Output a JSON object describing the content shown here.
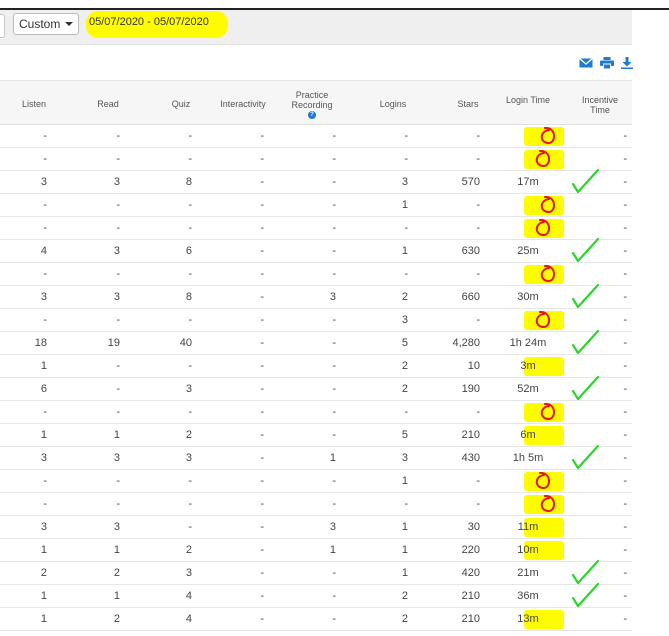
{
  "toolbar": {
    "period": "Custom",
    "date_range": "05/07/2020 - 05/07/2020"
  },
  "icons": {
    "email": "envelope-icon",
    "print": "printer-icon",
    "download": "download-icon"
  },
  "columns": [
    {
      "key": "listen",
      "label": "Listen"
    },
    {
      "key": "read",
      "label": "Read"
    },
    {
      "key": "quiz",
      "label": "Quiz"
    },
    {
      "key": "interactivity",
      "label": "Interactivity"
    },
    {
      "key": "practice",
      "label": "Practice Recording"
    },
    {
      "key": "logins",
      "label": "Logins"
    },
    {
      "key": "stars",
      "label": "Stars"
    },
    {
      "key": "login_time",
      "label": "Login Time"
    },
    {
      "key": "incentive",
      "label": "Incentive Time"
    }
  ],
  "rows": [
    [
      "-",
      "-",
      "-",
      "-",
      "-",
      "-",
      "-",
      "",
      "-"
    ],
    [
      "-",
      "-",
      "-",
      "-",
      "-",
      "-",
      "-",
      "",
      "-"
    ],
    [
      "3",
      "3",
      "8",
      "-",
      "-",
      "3",
      "570",
      "17m",
      "-"
    ],
    [
      "-",
      "-",
      "-",
      "-",
      "-",
      "1",
      "-",
      "",
      "-"
    ],
    [
      "-",
      "-",
      "-",
      "-",
      "-",
      "-",
      "-",
      "",
      "-"
    ],
    [
      "4",
      "3",
      "6",
      "-",
      "-",
      "1",
      "630",
      "25m",
      "-"
    ],
    [
      "-",
      "-",
      "-",
      "-",
      "-",
      "-",
      "-",
      "",
      "-"
    ],
    [
      "3",
      "3",
      "8",
      "-",
      "3",
      "2",
      "660",
      "30m",
      "-"
    ],
    [
      "-",
      "-",
      "-",
      "-",
      "-",
      "3",
      "-",
      "",
      "-"
    ],
    [
      "18",
      "19",
      "40",
      "-",
      "-",
      "5",
      "4,280",
      "1h 24m",
      "-"
    ],
    [
      "1",
      "-",
      "-",
      "-",
      "-",
      "2",
      "10",
      "3m",
      "-"
    ],
    [
      "6",
      "-",
      "3",
      "-",
      "-",
      "2",
      "190",
      "52m",
      "-"
    ],
    [
      "-",
      "-",
      "-",
      "-",
      "-",
      "-",
      "-",
      "",
      "-"
    ],
    [
      "1",
      "1",
      "2",
      "-",
      "-",
      "5",
      "210",
      "6m",
      "-"
    ],
    [
      "3",
      "3",
      "3",
      "-",
      "1",
      "3",
      "430",
      "1h 5m",
      "-"
    ],
    [
      "-",
      "-",
      "-",
      "-",
      "-",
      "1",
      "-",
      "",
      "-"
    ],
    [
      "-",
      "-",
      "-",
      "-",
      "-",
      "-",
      "-",
      "",
      "-"
    ],
    [
      "3",
      "3",
      "-",
      "-",
      "3",
      "1",
      "30",
      "11m",
      "-"
    ],
    [
      "1",
      "1",
      "2",
      "-",
      "1",
      "1",
      "220",
      "10m",
      "-"
    ],
    [
      "2",
      "2",
      "3",
      "-",
      "-",
      "1",
      "420",
      "21m",
      "-"
    ],
    [
      "1",
      "1",
      "4",
      "-",
      "-",
      "2",
      "210",
      "36m",
      "-"
    ],
    [
      "1",
      "2",
      "4",
      "-",
      "-",
      "2",
      "210",
      "13m",
      "-"
    ]
  ],
  "highlight_color": "#fffb00",
  "check_color": "#2bd62b",
  "circle_color": "#e01818"
}
